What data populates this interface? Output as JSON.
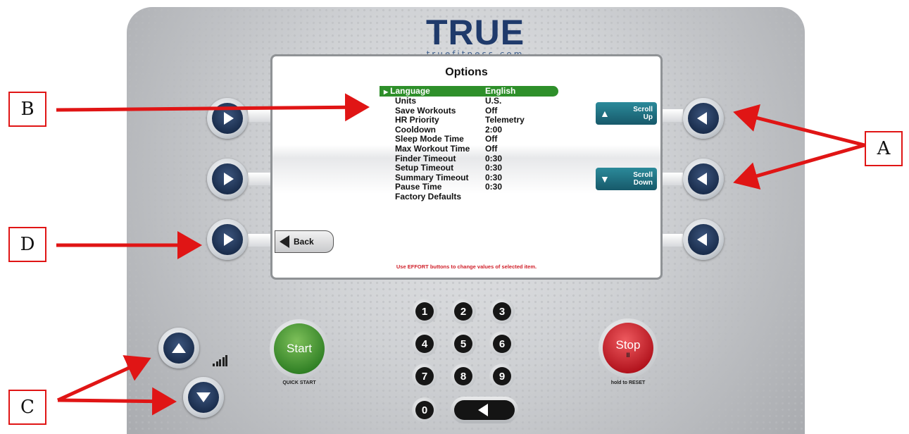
{
  "logo": {
    "word": "TRUE",
    "url": "truefitness.com"
  },
  "screen": {
    "title": "Options",
    "menu": [
      {
        "label": "Language",
        "value": "English",
        "selected": true
      },
      {
        "label": "Units",
        "value": "U.S."
      },
      {
        "label": "Save Workouts",
        "value": "Off"
      },
      {
        "label": "HR Priority",
        "value": "Telemetry"
      },
      {
        "label": "Cooldown",
        "value": "2:00"
      },
      {
        "label": "Sleep Mode Time",
        "value": "Off"
      },
      {
        "label": "Max Workout Time",
        "value": "Off"
      },
      {
        "label": "Finder Timeout",
        "value": "0:30"
      },
      {
        "label": "Setup Timeout",
        "value": "0:30"
      },
      {
        "label": "Summary Timeout",
        "value": "0:30"
      },
      {
        "label": "Pause Time",
        "value": "0:30"
      },
      {
        "label": "Factory Defaults",
        "value": ""
      }
    ],
    "note": "Use EFFORT buttons to change values of selected item.",
    "back_label": "Back",
    "scroll_up": {
      "line1": "Scroll",
      "line2": "Up"
    },
    "scroll_down": {
      "line1": "Scroll",
      "line2": "Down"
    }
  },
  "keypad": {
    "keys": [
      "1",
      "2",
      "3",
      "4",
      "5",
      "6",
      "7",
      "8",
      "9",
      "0"
    ]
  },
  "start": {
    "label": "Start",
    "sublabel": "QUICK START"
  },
  "stop": {
    "label": "Stop",
    "pause_glyph": "II",
    "sublabel": "hold to RESET"
  },
  "callouts": {
    "a": "A",
    "b": "B",
    "c": "C",
    "d": "D"
  },
  "colors": {
    "selected_row": "#2e8f2a",
    "note": "#d0202a",
    "arrow": "#e01515",
    "button_core": "#1f3558"
  },
  "icons": {
    "selected_marker": "▶",
    "scroll_up": "▲",
    "scroll_down": "▼"
  }
}
